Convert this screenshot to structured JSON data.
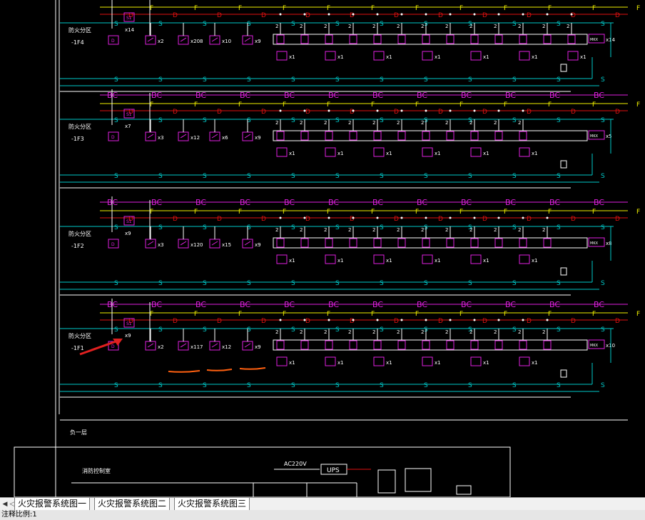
{
  "drawing": {
    "floors": [
      {
        "title": "防火分区",
        "code": "-1F4",
        "counts": {
          "s1": "x14",
          "d": "x2",
          "h": "x208",
          "x": "x10",
          "t": "x9"
        },
        "mod_count": "x14",
        "mod_label": "MKX"
      },
      {
        "title": "防火分区",
        "code": "-1F3",
        "counts": {
          "s1": "x7",
          "d": "x3",
          "h": "x12",
          "x": "x6",
          "t": "x9"
        },
        "mod_count": "x5",
        "mod_label": "MKX"
      },
      {
        "title": "防火分区",
        "code": "-1F2",
        "counts": {
          "s1": "x9",
          "d": "x3",
          "h": "x120",
          "x": "x15",
          "t": "x9"
        },
        "mod_count": "x8",
        "mod_label": "MKX"
      },
      {
        "title": "防火分区",
        "code": "-1F1",
        "counts": {
          "s1": "x9",
          "d": "x2",
          "h": "x117",
          "x": "x12",
          "t": "x9"
        },
        "mod_count": "x10",
        "mod_label": "MKX"
      }
    ],
    "bus_labels": {
      "s": "S",
      "f": "F",
      "d": "D",
      "bc": "BC",
      "num": "2"
    },
    "mid_labels": {
      "floor_hint": "负一层",
      "room": "消防控制室",
      "power": "AC220V",
      "ups": "UPS"
    },
    "colors": {
      "s_bus": "#00c8c8",
      "f_bus": "#f0f000",
      "d_bus": "#e01010",
      "bc_bus": "#e020e0",
      "device": "#e020e0",
      "text": "#ffffff",
      "annotation_arrow": "#e02020",
      "underline": "#ff6010"
    }
  },
  "tabs": [
    {
      "label": "火灾报警系统图一"
    },
    {
      "label": "火灾报警系统图二"
    },
    {
      "label": "火灾报警系统图三"
    }
  ],
  "status": {
    "text": "注释比例:1"
  }
}
